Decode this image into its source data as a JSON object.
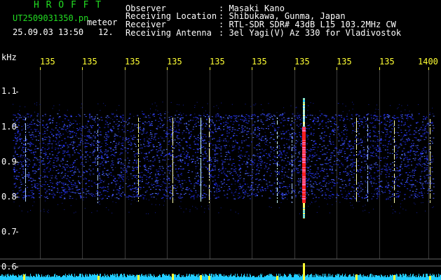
{
  "app": {
    "name": "HROFFT"
  },
  "header": {
    "logo": "H R O F F T",
    "filename": "UT2509031350.pn",
    "tag": "meteor",
    "datetime": "25.09.03 13:50",
    "counter": "12.",
    "fields": [
      {
        "label": "Observer",
        "value": ": Masaki Kano"
      },
      {
        "label": "Receiving Location",
        "value": ": Shibukawa, Gunma, Japan"
      },
      {
        "label": "Receiver",
        "value": ": RTL-SDR SDR# 43dB L15 103.2MHz CW"
      },
      {
        "label": "Receiving Antenna",
        "value": ": 3el Yagi(V) Az 330 for Vladivostok"
      }
    ]
  },
  "axis": {
    "unit_label": "kHz",
    "x_ticks": [
      "135",
      "135",
      "135",
      "135",
      "135",
      "135",
      "135",
      "135",
      "135",
      "1400"
    ],
    "y_ticks": [
      "1.1",
      "1.0",
      "0.9",
      "0.8",
      "0.7",
      "0.6"
    ]
  },
  "colors": {
    "background": "#000000",
    "text_green": "#22dd22",
    "text_white": "#ffffff",
    "tick_yellow": "#ffff33",
    "noise_blue": "#2233ff",
    "baseline_cyan": "#22ccff",
    "signal_red": "#ff2020"
  }
}
